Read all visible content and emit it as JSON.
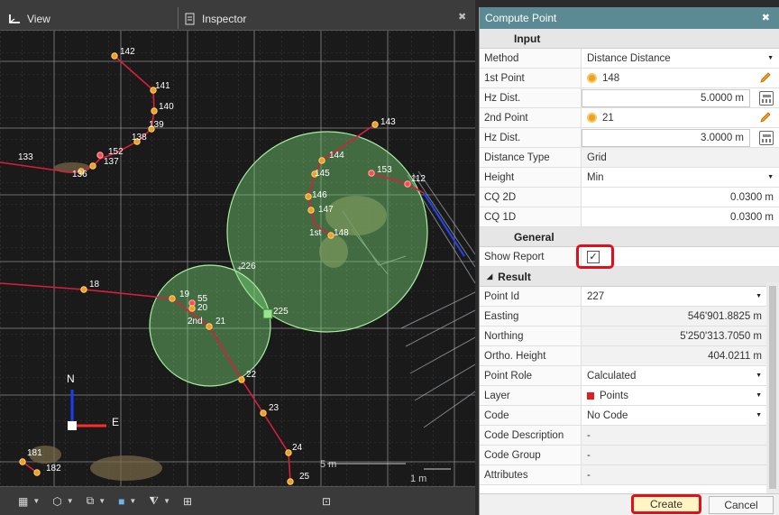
{
  "tabs": {
    "view": "View",
    "inspector": "Inspector"
  },
  "colors": {
    "accent": "#5c8a94",
    "highlight": "#e0101a",
    "point": "#f0a020",
    "polyline": "#d81f3c",
    "circle": "#7ddc7a"
  },
  "map": {
    "points": [
      {
        "label": "142"
      },
      {
        "label": "141"
      },
      {
        "label": "140"
      },
      {
        "label": "139"
      },
      {
        "label": "138"
      },
      {
        "label": "152"
      },
      {
        "label": "137"
      },
      {
        "label": "133"
      },
      {
        "label": "136"
      },
      {
        "label": "143"
      },
      {
        "label": "144"
      },
      {
        "label": "145"
      },
      {
        "label": "153"
      },
      {
        "label": "112"
      },
      {
        "label": "146"
      },
      {
        "label": "147"
      },
      {
        "label": "148"
      },
      {
        "label": "1st"
      },
      {
        "label": "226"
      },
      {
        "label": "225"
      },
      {
        "label": "18"
      },
      {
        "label": "19"
      },
      {
        "label": "55"
      },
      {
        "label": "20"
      },
      {
        "label": "21"
      },
      {
        "label": "2nd"
      },
      {
        "label": "22"
      },
      {
        "label": "23"
      },
      {
        "label": "24"
      },
      {
        "label": "25"
      },
      {
        "label": "181"
      },
      {
        "label": "182"
      }
    ],
    "axis_n": "N",
    "axis_e": "E",
    "scale_5m": "5 m",
    "scale_1m": "1 m"
  },
  "panel": {
    "title": "Compute Point",
    "input_header": "Input",
    "general_header": "General",
    "result_header": "Result",
    "rows": {
      "method": {
        "label": "Method",
        "value": "Distance Distance"
      },
      "first_point": {
        "label": "1st Point",
        "value": "148"
      },
      "hz_dist1": {
        "label": "Hz Dist.",
        "value": "5.0000 m"
      },
      "second_point": {
        "label": "2nd Point",
        "value": "21"
      },
      "hz_dist2": {
        "label": "Hz Dist.",
        "value": "3.0000 m"
      },
      "distance_type": {
        "label": "Distance Type",
        "value": "Grid"
      },
      "height": {
        "label": "Height",
        "value": "Min"
      },
      "cq2d": {
        "label": "CQ 2D",
        "value": "0.0300 m"
      },
      "cq1d": {
        "label": "CQ 1D",
        "value": "0.0300 m"
      },
      "show_report": {
        "label": "Show Report",
        "checked": true
      },
      "point_id": {
        "label": "Point Id",
        "value": "227"
      },
      "easting": {
        "label": "Easting",
        "value": "546'901.8825 m"
      },
      "northing": {
        "label": "Northing",
        "value": "5'250'313.7050 m"
      },
      "ortho": {
        "label": "Ortho. Height",
        "value": "404.0211 m"
      },
      "point_role": {
        "label": "Point Role",
        "value": "Calculated"
      },
      "layer": {
        "label": "Layer",
        "value": "Points"
      },
      "code": {
        "label": "Code",
        "value": "No Code"
      },
      "code_desc": {
        "label": "Code Description",
        "value": "-"
      },
      "code_group": {
        "label": "Code Group",
        "value": "-"
      },
      "attributes": {
        "label": "Attributes",
        "value": "-"
      }
    },
    "create": "Create",
    "cancel": "Cancel"
  }
}
